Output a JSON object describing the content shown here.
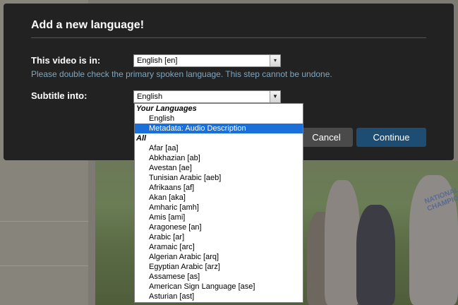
{
  "modal": {
    "title": "Add a new language!",
    "video_label": "This video is in:",
    "video_select_value": "English [en]",
    "hint": "Please double check the primary spoken language. This step cannot be undone.",
    "subtitle_label": "Subtitle into:",
    "subtitle_select_value": "English",
    "cancel_label": "Cancel",
    "continue_label": "Continue"
  },
  "dropdown": {
    "groups": [
      {
        "label": "Your Languages",
        "items": [
          "English",
          "Metadata: Audio Description"
        ]
      },
      {
        "label": "All",
        "items": [
          "Afar [aa]",
          "Abkhazian [ab]",
          "Avestan [ae]",
          "Tunisian Arabic [aeb]",
          "Afrikaans [af]",
          "Akan [aka]",
          "Amharic [amh]",
          "Amis [ami]",
          "Aragonese [an]",
          "Arabic [ar]",
          "Aramaic [arc]",
          "Algerian Arabic [arq]",
          "Egyptian Arabic [arz]",
          "Assamese [as]",
          "American Sign Language [ase]",
          "Asturian [ast]"
        ]
      }
    ],
    "highlighted": "Metadata: Audio Description"
  },
  "background": {
    "jersey_text": "NATIONAL CHAMPIONS"
  },
  "colors": {
    "modal_bg": "#222222",
    "hint": "#7fa6c0",
    "continue_bg": "#1e4d74",
    "cancel_bg": "#4a4a4a",
    "highlight": "#1a6fd8"
  }
}
